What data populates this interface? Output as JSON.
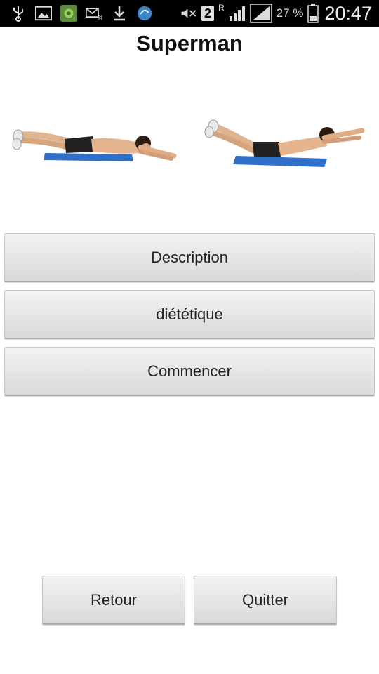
{
  "status_bar": {
    "network_indicator": "2",
    "roaming_indicator": "R",
    "battery_percent": "27 %",
    "time": "20:47",
    "left_icons": [
      "usb-icon",
      "image-icon",
      "app-icon",
      "email-icon",
      "download-icon",
      "sync-icon"
    ],
    "right_icons": [
      "mute-icon",
      "signal-icon",
      "battery-icon"
    ]
  },
  "screen": {
    "title": "Superman"
  },
  "buttons": {
    "description": "Description",
    "dietetique": "diététique",
    "commencer": "Commencer",
    "retour": "Retour",
    "quitter": "Quitter"
  },
  "colors": {
    "status_bar_bg": "#000000",
    "background": "#ffffff",
    "mat": "#2f6fc8"
  }
}
